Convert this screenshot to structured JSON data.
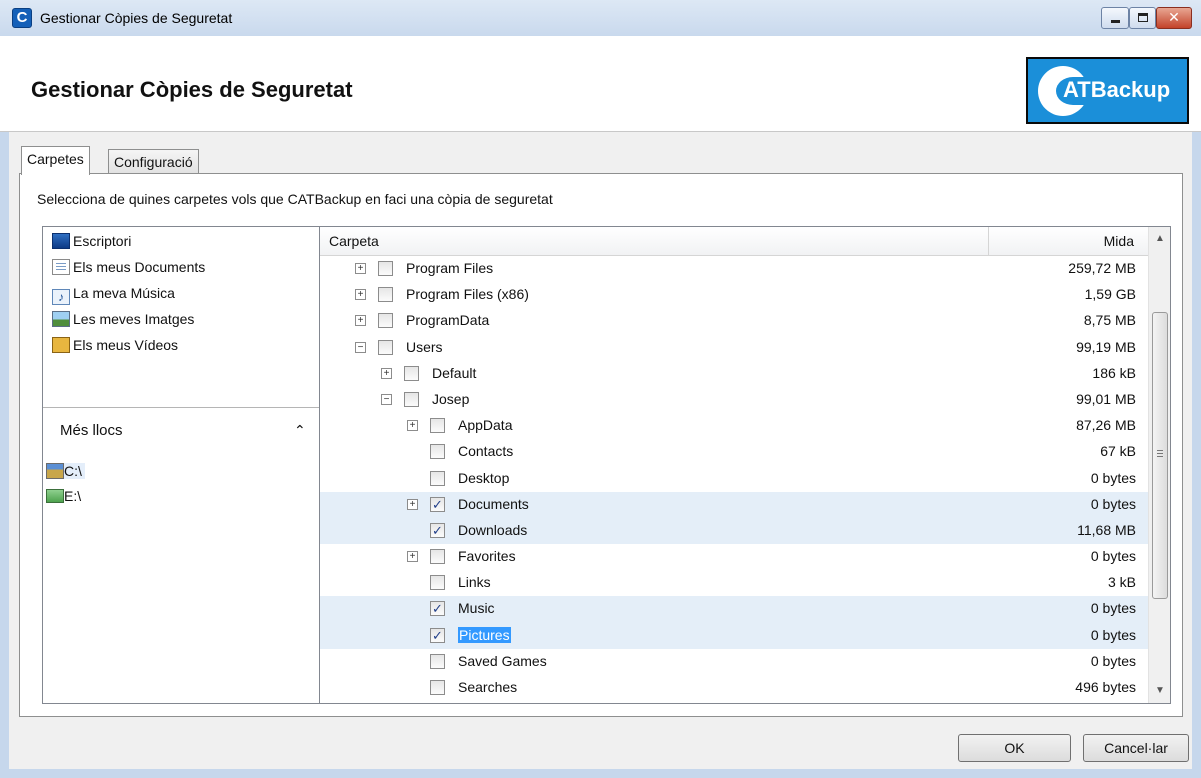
{
  "window": {
    "title": "Gestionar Còpies de Seguretat",
    "close_glyph": "✕"
  },
  "header": {
    "title": "Gestionar Còpies de Seguretat",
    "logo_text": "ATBackup"
  },
  "tabs": [
    {
      "label": "Carpetes",
      "active": true
    },
    {
      "label": "Configuració",
      "active": false
    }
  ],
  "instructions": "Selecciona de quines carpetes vols que CATBackup en faci una còpia de seguretat",
  "quick_access": [
    {
      "label": "Escriptori",
      "icon": "desktop-icon"
    },
    {
      "label": "Els meus Documents",
      "icon": "documents-icon"
    },
    {
      "label": "La meva Música",
      "icon": "music-icon"
    },
    {
      "label": "Les meves Imatges",
      "icon": "pictures-icon"
    },
    {
      "label": "Els meus Vídeos",
      "icon": "videos-icon"
    }
  ],
  "more_places": {
    "label": "Més llocs",
    "collapse_glyph": "⌃",
    "drives": [
      {
        "label": "C:\\",
        "icon": "hard-drive-icon",
        "selected": true
      },
      {
        "label": "E:\\",
        "icon": "network-drive-icon",
        "selected": false
      }
    ]
  },
  "table": {
    "columns": {
      "folder": "Carpeta",
      "size": "Mida"
    },
    "rows": [
      {
        "name": "Program Files",
        "size": "259,72 MB",
        "level": 0,
        "expander": "+",
        "checked": false,
        "selected": false
      },
      {
        "name": "Program Files (x86)",
        "size": "1,59 GB",
        "level": 0,
        "expander": "+",
        "checked": false,
        "selected": false
      },
      {
        "name": "ProgramData",
        "size": "8,75 MB",
        "level": 0,
        "expander": "+",
        "checked": false,
        "selected": false
      },
      {
        "name": "Users",
        "size": "99,19 MB",
        "level": 0,
        "expander": "−",
        "checked": false,
        "selected": false
      },
      {
        "name": "Default",
        "size": "186 kB",
        "level": 1,
        "expander": "+",
        "checked": false,
        "selected": false
      },
      {
        "name": "Josep",
        "size": "99,01 MB",
        "level": 1,
        "expander": "−",
        "checked": false,
        "selected": false
      },
      {
        "name": "AppData",
        "size": "87,26 MB",
        "level": 2,
        "expander": "+",
        "checked": false,
        "selected": false
      },
      {
        "name": "Contacts",
        "size": "67 kB",
        "level": 2,
        "expander": "",
        "checked": false,
        "selected": false
      },
      {
        "name": "Desktop",
        "size": "0 bytes",
        "level": 2,
        "expander": "",
        "checked": false,
        "selected": false
      },
      {
        "name": "Documents",
        "size": "0 bytes",
        "level": 2,
        "expander": "+",
        "checked": true,
        "selected": true
      },
      {
        "name": "Downloads",
        "size": "11,68 MB",
        "level": 2,
        "expander": "",
        "checked": true,
        "selected": true
      },
      {
        "name": "Favorites",
        "size": "0 bytes",
        "level": 2,
        "expander": "+",
        "checked": false,
        "selected": false
      },
      {
        "name": "Links",
        "size": "3 kB",
        "level": 2,
        "expander": "",
        "checked": false,
        "selected": false
      },
      {
        "name": "Music",
        "size": "0 bytes",
        "level": 2,
        "expander": "",
        "checked": true,
        "selected": true
      },
      {
        "name": "Pictures",
        "size": "0 bytes",
        "level": 2,
        "expander": "",
        "checked": true,
        "selected": true,
        "focused": true
      },
      {
        "name": "Saved Games",
        "size": "0 bytes",
        "level": 2,
        "expander": "",
        "checked": false,
        "selected": false
      },
      {
        "name": "Searches",
        "size": "496 bytes",
        "level": 2,
        "expander": "",
        "checked": false,
        "selected": false
      }
    ],
    "scroll_up_glyph": "▲",
    "scroll_down_glyph": "▼"
  },
  "buttons": {
    "ok": "OK",
    "cancel": "Cancel·lar"
  },
  "colors": {
    "selection_row": "#e4eef8",
    "focus_highlight": "#3399ff",
    "logo_blue": "#1b8fd9"
  }
}
